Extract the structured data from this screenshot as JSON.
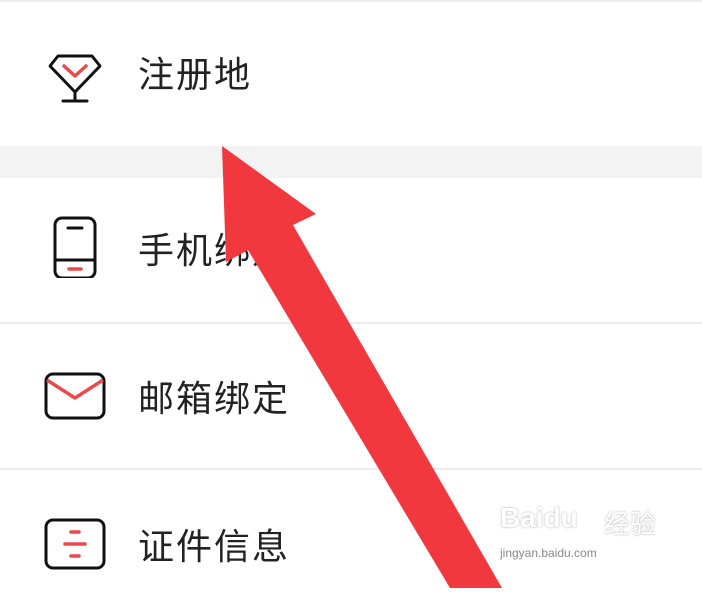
{
  "menu": {
    "items": [
      {
        "label": "注册地",
        "icon": "location-diamond-icon"
      },
      {
        "label": "手机绑定",
        "icon": "phone-icon"
      },
      {
        "label": "邮箱绑定",
        "icon": "envelope-icon"
      },
      {
        "label": "证件信息",
        "icon": "id-card-icon"
      }
    ]
  },
  "watermark": {
    "brand": "Baidu",
    "suffix": "经验",
    "domain": "jingyan.baidu.com"
  },
  "colors": {
    "accent": "#e94b4b",
    "arrow": "#f2383f",
    "icon_stroke": "#111111",
    "divider": "#ececec",
    "section_gap": "#f3f3f3"
  }
}
